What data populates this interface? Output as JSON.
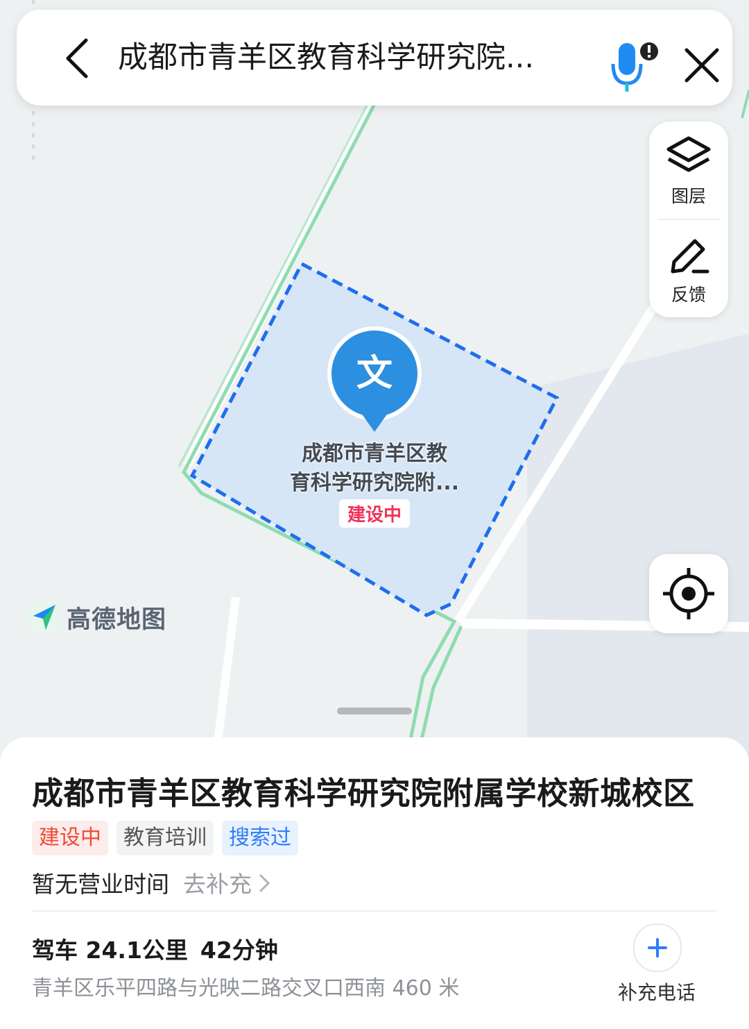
{
  "search": {
    "query": "成都市青羊区教育科学研究院...",
    "back_icon": "chevron-left-icon",
    "mic_icon": "microphone-icon",
    "close_icon": "close-icon"
  },
  "map_tools": {
    "layers_label": "图层",
    "feedback_label": "反馈",
    "locate_icon": "crosshair-icon"
  },
  "brand": {
    "name": "高德地图"
  },
  "poi_marker": {
    "icon_text": "文",
    "name_line1": "成都市青羊区教",
    "name_line2": "育科学研究院附...",
    "status": "建设中"
  },
  "place": {
    "title": "成都市青羊区教育科学研究院附属学校新城校区",
    "tags": [
      {
        "label": "建设中",
        "color": "#f04a32"
      },
      {
        "label": "教育培训",
        "color": "#555555"
      },
      {
        "label": "搜索过",
        "color": "#2f7df6"
      }
    ],
    "hours": "暂无营业时间",
    "hours_add": "去补充",
    "drive_distance": "驾车 24.1公里",
    "drive_time": "42分钟",
    "address": "青羊区乐平四路与光映二路交叉口西南 460 米",
    "add_phone_label": "补充电话"
  },
  "colors": {
    "accent_blue": "#2f7df6",
    "poi_fill": "#d6e6f6",
    "poi_border": "#1f6df0",
    "green_road": "#8fdcb0"
  }
}
